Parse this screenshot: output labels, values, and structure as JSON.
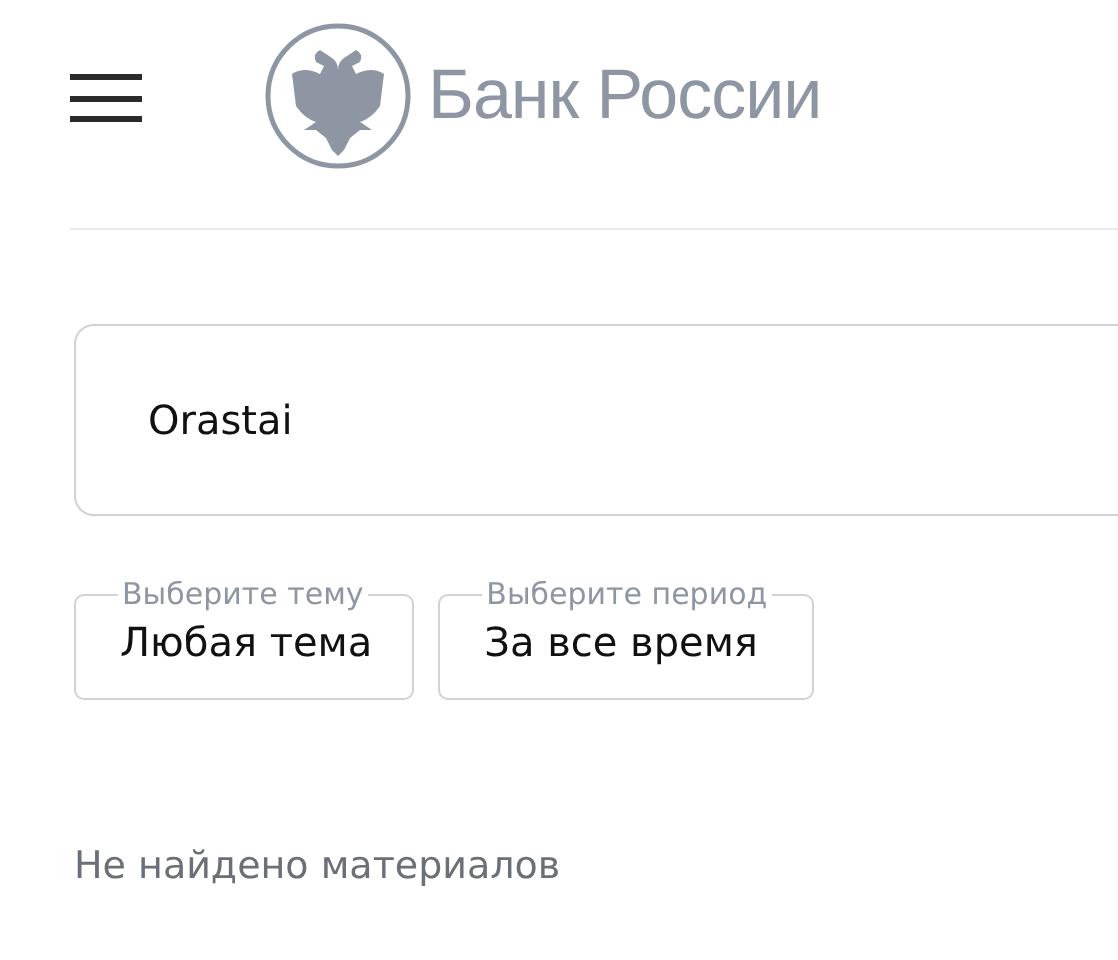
{
  "header": {
    "site_name": "Банк России"
  },
  "search": {
    "value": "Orastai"
  },
  "filters": [
    {
      "label": "Выберите тему",
      "value": "Любая тема"
    },
    {
      "label": "Выберите период",
      "value": "За все время"
    }
  ],
  "message": "Не найдено материалов"
}
